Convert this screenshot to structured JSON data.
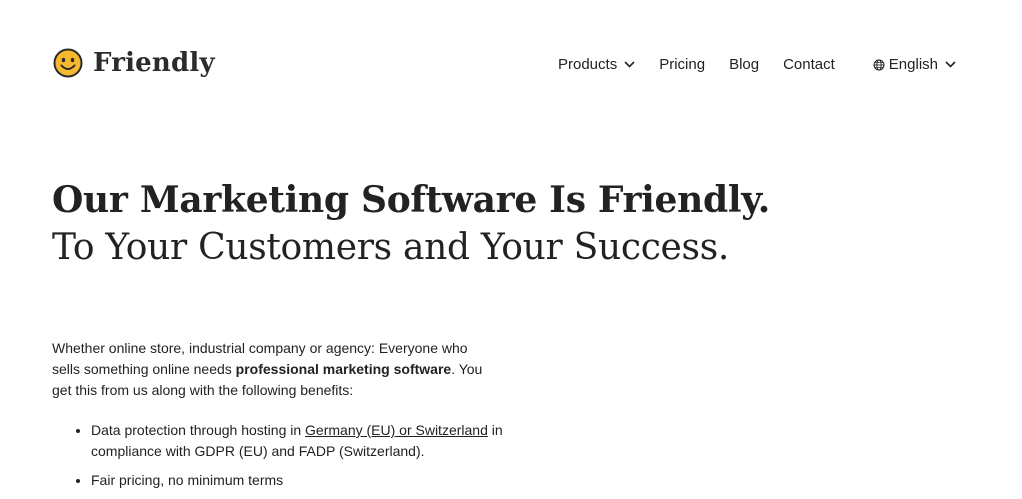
{
  "brand": {
    "name": "Friendly",
    "logo_icon": "smiley-face-icon",
    "logo_color": "#f5b82e"
  },
  "nav": {
    "products": "Products",
    "pricing": "Pricing",
    "blog": "Blog",
    "contact": "Contact",
    "language": "English",
    "language_icon": "globe-icon"
  },
  "hero": {
    "headline": "Our Marketing Software Is Friendly.",
    "subheadline": "To Your Customers and Your Success."
  },
  "intro": {
    "text_before": "Whether online store, industrial company or agency: Everyone who sells something online needs ",
    "emphasis": "professional marketing software",
    "text_after": ". You get this from us along with the following benefits:"
  },
  "benefits": [
    {
      "text_before": "Data protection through hosting in ",
      "link1": "Germany (EU)",
      "between": " or ",
      "link2": "Switzerland",
      "text_after": " in compliance with GDPR (EU) and FADP (Switzerland)."
    },
    {
      "text": "Fair pricing, no minimum terms"
    }
  ]
}
